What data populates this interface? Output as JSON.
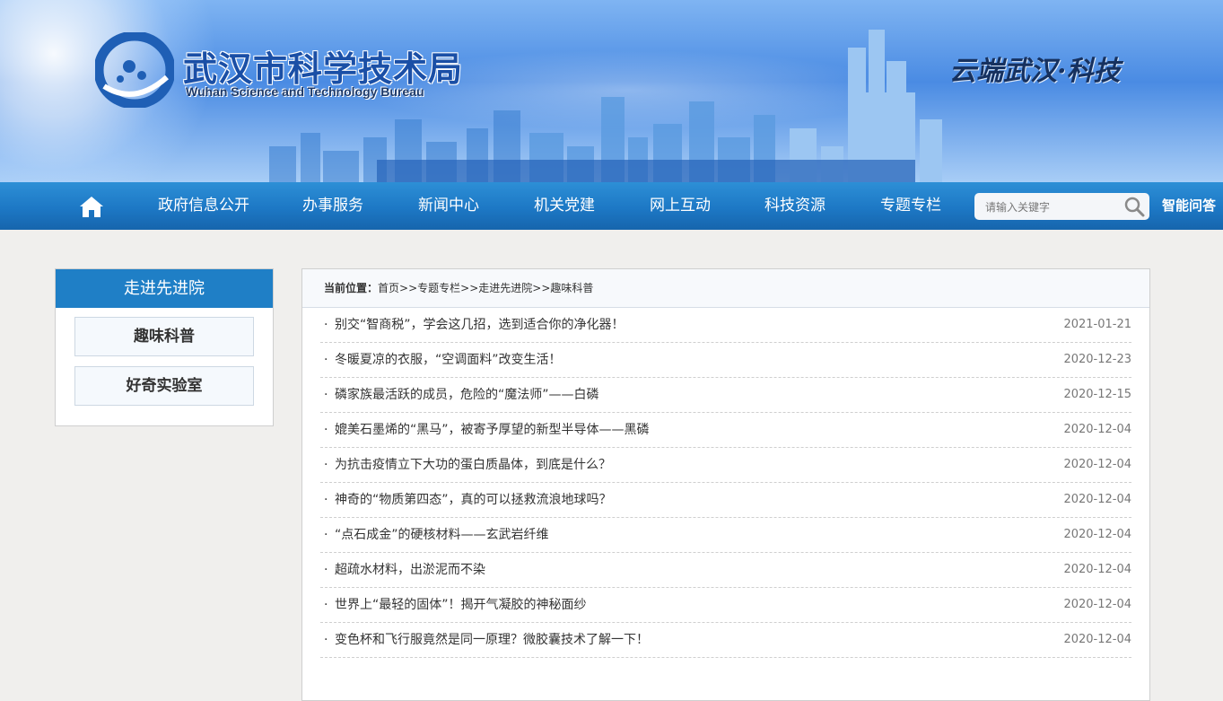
{
  "header": {
    "org_name_cn": "武汉市科学技术局",
    "org_name_en": "Wuhan Science and Technology Bureau",
    "slogan": "云端武汉·科技"
  },
  "nav": {
    "items": [
      "政府信息公开",
      "办事服务",
      "新闻中心",
      "机关党建",
      "网上互动",
      "科技资源",
      "专题专栏"
    ],
    "search_placeholder": "请输入关键字",
    "smart_qa": "智能问答"
  },
  "sidebar": {
    "title": "走进先进院",
    "items": [
      "趣味科普",
      "好奇实验室"
    ]
  },
  "breadcrumb": {
    "label": "当前位置：",
    "path": [
      "首页",
      "专题专栏",
      "走进先进院",
      "趣味科普"
    ],
    "separator": ">>"
  },
  "articles": [
    {
      "title": "别交“智商税”，学会这几招，选到适合你的净化器！",
      "date": "2021-01-21"
    },
    {
      "title": "冬暖夏凉的衣服，“空调面料”改变生活！",
      "date": "2020-12-23"
    },
    {
      "title": "磷家族最活跃的成员，危险的“魔法师”——白磷",
      "date": "2020-12-15"
    },
    {
      "title": "媲美石墨烯的“黑马”，被寄予厚望的新型半导体——黑磷",
      "date": "2020-12-04"
    },
    {
      "title": "为抗击疫情立下大功的蛋白质晶体，到底是什么？",
      "date": "2020-12-04"
    },
    {
      "title": "神奇的“物质第四态”，真的可以拯救流浪地球吗？",
      "date": "2020-12-04"
    },
    {
      "title": "“点石成金”的硬核材料——玄武岩纤维",
      "date": "2020-12-04"
    },
    {
      "title": "超疏水材料，出淤泥而不染",
      "date": "2020-12-04"
    },
    {
      "title": "世界上“最轻的固体”！揭开气凝胶的神秘面纱",
      "date": "2020-12-04"
    },
    {
      "title": "变色杯和飞行服竟然是同一原理？微胶囊技术了解一下！",
      "date": "2020-12-04"
    }
  ],
  "icons": {
    "home": "home-icon",
    "search": "search-icon",
    "logo": "logo-icon",
    "bullet": "·"
  },
  "colors": {
    "nav_bg": "#1d78c5",
    "sidebar_head": "#1f7fc6",
    "logo_text": "#1a4fa6"
  }
}
